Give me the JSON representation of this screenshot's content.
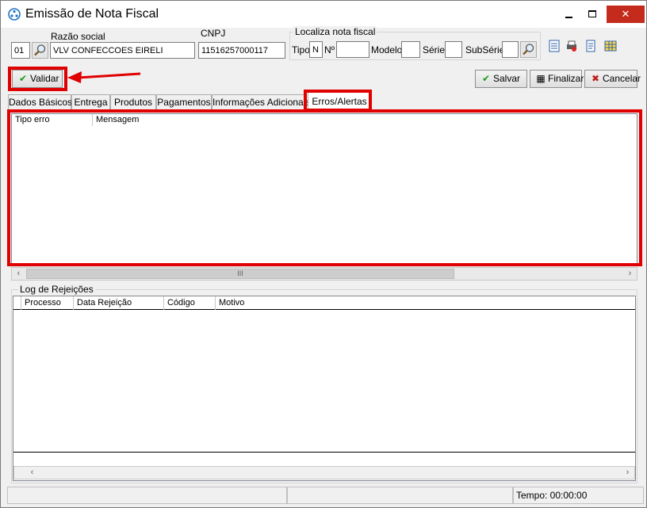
{
  "window": {
    "title": "Emissão de Nota Fiscal",
    "controls": [
      "minimize",
      "maximize",
      "close"
    ]
  },
  "header": {
    "code_value": "01",
    "razao_label": "Razão social",
    "razao_value": "VLV CONFECCOES EIRELI",
    "cnpj_label": "CNPJ",
    "cnpj_value": "11516257000117",
    "localiza_title": "Localiza nota fiscal",
    "tipo_label": "Tipo",
    "tipo_value": "N",
    "numero_label": "Nº",
    "numero_value": "",
    "modelo_label": "Modelo",
    "modelo_value": "",
    "serie_label": "Série",
    "serie_value": "",
    "subserie_label": "SubSérie",
    "subserie_value": "",
    "tool_icons": [
      "list-icon",
      "printer-icon",
      "document-icon",
      "grid-icon"
    ]
  },
  "toolbar": {
    "validar_label": "Validar",
    "salvar_label": "Salvar",
    "finalizar_label": "Finalizar",
    "cancelar_label": "Cancelar"
  },
  "tabs": [
    {
      "label": "Dados Básicos"
    },
    {
      "label": "Entrega"
    },
    {
      "label": "Produtos"
    },
    {
      "label": "Pagamentos"
    },
    {
      "label": "Informações Adicionais"
    },
    {
      "label": "Erros/Alertas",
      "active": true
    }
  ],
  "errors_grid": {
    "columns": [
      "Tipo erro",
      "Mensagem"
    ],
    "rows": [],
    "scroll_thumb": "III"
  },
  "log": {
    "title": "Log de Rejeições",
    "columns": [
      "Processo",
      "Data Rejeição",
      "Código",
      "Motivo"
    ],
    "rows": []
  },
  "status": {
    "panel1": "",
    "panel2": "",
    "tempo": "Tempo: 00:00:00"
  },
  "colors": {
    "highlight": "#e00000",
    "check_green": "#1a9a1a",
    "cancel_red": "#c0201b"
  }
}
